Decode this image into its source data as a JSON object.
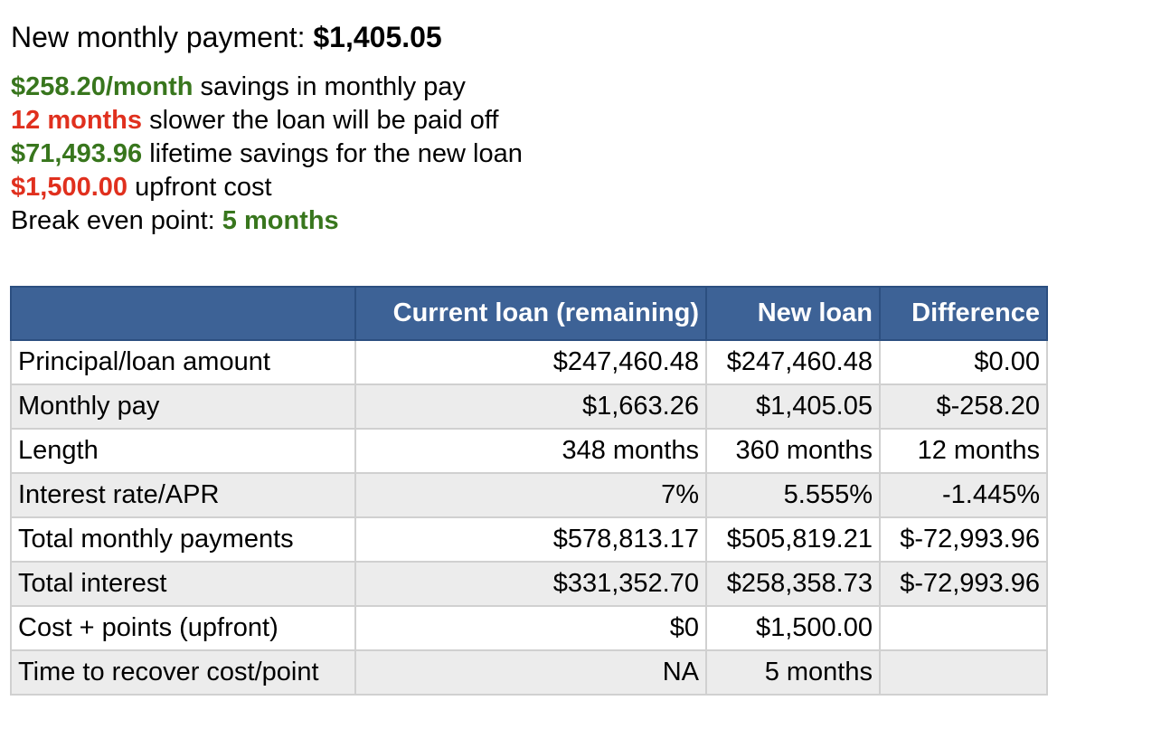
{
  "headline": {
    "label": "New monthly payment:",
    "value": "$1,405.05"
  },
  "summary": [
    {
      "value": "$258.20/month",
      "text": "savings in monthly pay",
      "color": "#38761d"
    },
    {
      "value": "12 months",
      "text": "slower the loan will be paid off",
      "color": "#e0301e"
    },
    {
      "value": "$71,493.96",
      "text": "lifetime savings for the new loan",
      "color": "#38761d"
    },
    {
      "value": "$1,500.00",
      "text": "upfront cost",
      "color": "#e0301e"
    }
  ],
  "break_even": {
    "label": "Break even point:",
    "value": "5 months",
    "color": "#38761d"
  },
  "table": {
    "header_color": "#3d6296",
    "columns": [
      "",
      "Current loan (remaining)",
      "New loan",
      "Difference"
    ],
    "rows": [
      [
        "Principal/loan amount",
        "$247,460.48",
        "$247,460.48",
        "$0.00"
      ],
      [
        "Monthly pay",
        "$1,663.26",
        "$1,405.05",
        "$-258.20"
      ],
      [
        "Length",
        "348 months",
        "360 months",
        "12 months"
      ],
      [
        "Interest rate/APR",
        "7%",
        "5.555%",
        "-1.445%"
      ],
      [
        "Total monthly payments",
        "$578,813.17",
        "$505,819.21",
        "$-72,993.96"
      ],
      [
        "Total interest",
        "$331,352.70",
        "$258,358.73",
        "$-72,993.96"
      ],
      [
        "Cost + points (upfront)",
        "$0",
        "$1,500.00",
        ""
      ],
      [
        "Time to recover cost/point",
        "NA",
        "5 months",
        ""
      ]
    ]
  }
}
